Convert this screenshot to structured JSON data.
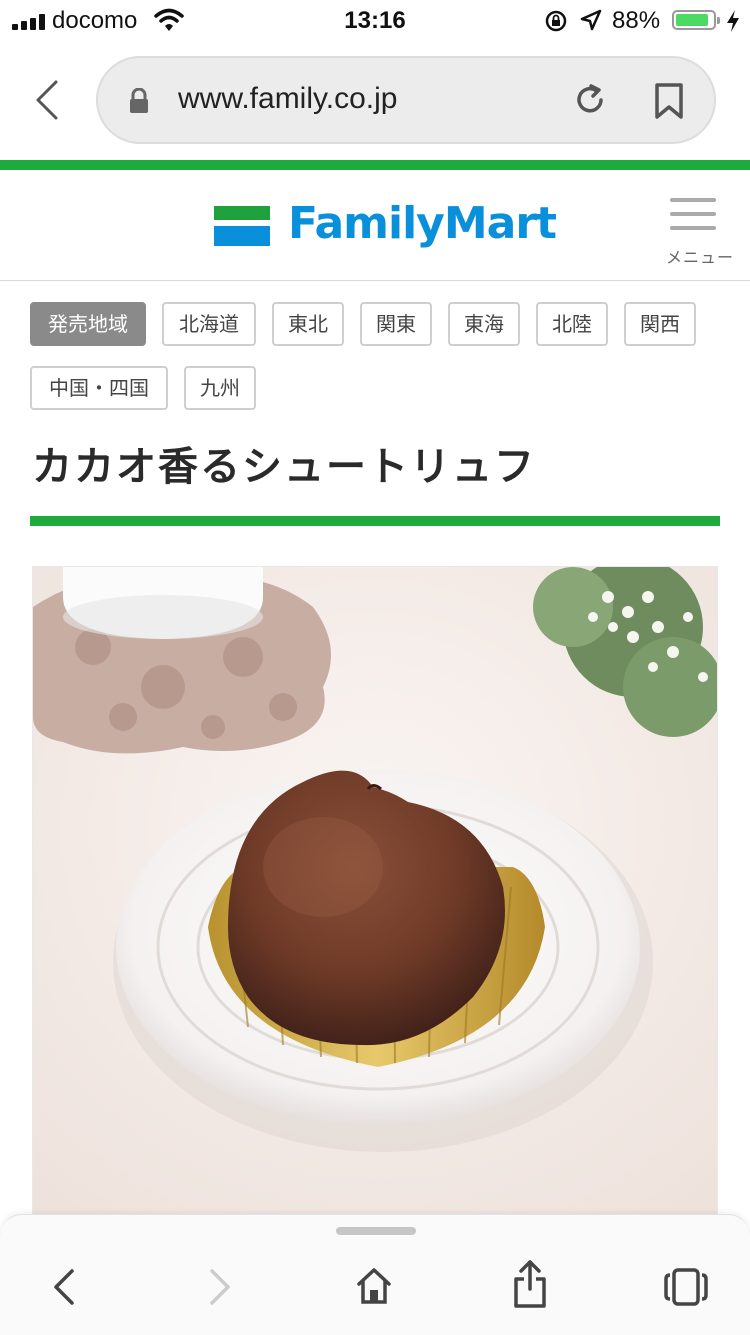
{
  "status_bar": {
    "carrier": "docomo",
    "time": "13:16",
    "battery_percent": "88%",
    "battery_level": 0.88
  },
  "browser": {
    "url": "www.family.co.jp"
  },
  "header": {
    "logo_text": "FamilyMart",
    "menu_label": "メニュー",
    "brand_colors": {
      "green": "#1faa3d",
      "blue": "#0a8fdb"
    }
  },
  "regions": {
    "heading": "発売地域",
    "items": [
      "北海道",
      "東北",
      "関東",
      "東海",
      "北陸",
      "関西",
      "中国・四国",
      "九州"
    ]
  },
  "product": {
    "name": "カカオ香るシュートリュフ"
  }
}
